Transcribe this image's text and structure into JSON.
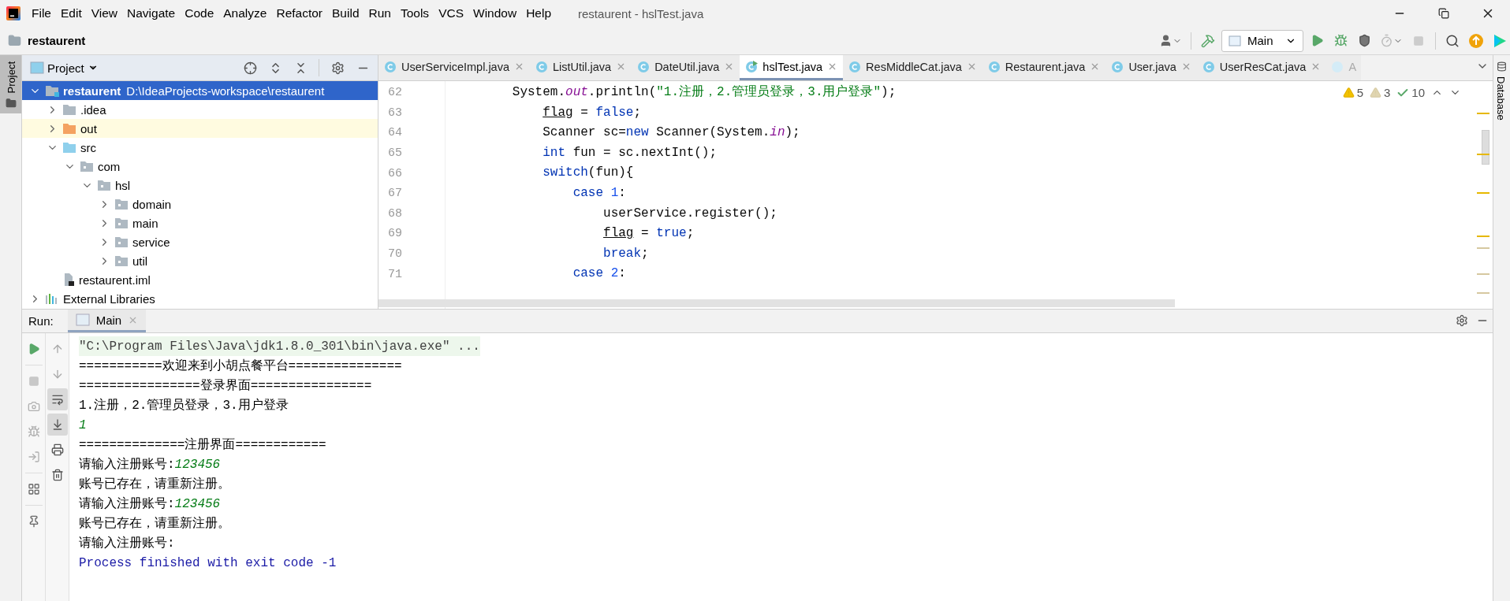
{
  "menu": [
    "File",
    "Edit",
    "View",
    "Navigate",
    "Code",
    "Analyze",
    "Refactor",
    "Build",
    "Run",
    "Tools",
    "VCS",
    "Window",
    "Help"
  ],
  "window": {
    "title": "restaurent - hslTest.java"
  },
  "breadcrumb": "restaurent",
  "run_config": "Main",
  "left_stripe": [
    "Project"
  ],
  "project_panel": {
    "title": "Project",
    "tree": [
      {
        "label": "restaurent",
        "path": "D:\\IdeaProjects-workspace\\restaurent",
        "kind": "module",
        "expanded": true,
        "selected": true,
        "children": [
          {
            "label": ".idea",
            "kind": "folder",
            "expanded": false,
            "selected": false
          },
          {
            "label": "out",
            "kind": "excluded",
            "expanded": false,
            "selected": false
          },
          {
            "label": "src",
            "kind": "source",
            "expanded": true,
            "selected": false,
            "children": [
              {
                "label": "com",
                "kind": "package",
                "expanded": true,
                "selected": false,
                "children": [
                  {
                    "label": "hsl",
                    "kind": "package",
                    "expanded": true,
                    "selected": false,
                    "children": [
                      {
                        "label": "domain",
                        "kind": "package",
                        "expanded": false,
                        "selected": false
                      },
                      {
                        "label": "main",
                        "kind": "package",
                        "expanded": false,
                        "selected": false
                      },
                      {
                        "label": "service",
                        "kind": "package",
                        "expanded": false,
                        "selected": false
                      },
                      {
                        "label": "util",
                        "kind": "package",
                        "expanded": false,
                        "selected": false
                      }
                    ]
                  }
                ]
              }
            ]
          },
          {
            "label": "restaurent.iml",
            "kind": "file",
            "selected": false
          }
        ]
      },
      {
        "label": "External Libraries",
        "kind": "libraries",
        "expanded": false,
        "selected": false
      }
    ]
  },
  "editor": {
    "tabs": [
      {
        "label": "UserServiceImpl.java",
        "selected": false,
        "runnable": false
      },
      {
        "label": "ListUtil.java",
        "selected": false,
        "runnable": false
      },
      {
        "label": "DateUtil.java",
        "selected": false,
        "runnable": false
      },
      {
        "label": "hslTest.java",
        "selected": true,
        "runnable": true
      },
      {
        "label": "ResMiddleCat.java",
        "selected": false,
        "runnable": false
      },
      {
        "label": "Restaurent.java",
        "selected": false,
        "runnable": false
      },
      {
        "label": "User.java",
        "selected": false,
        "runnable": false
      },
      {
        "label": "UserResCat.java",
        "selected": false,
        "runnable": false
      },
      {
        "label": "A",
        "selected": false,
        "runnable": false,
        "cut": true
      }
    ],
    "inspections": [
      {
        "kind": "warning",
        "count": "5"
      },
      {
        "kind": "weak",
        "count": "3"
      },
      {
        "kind": "typo",
        "count": "10"
      }
    ],
    "lines": [
      {
        "number": "62",
        "tokens": [
          {
            "kind": "plain",
            "text": "        System."
          },
          {
            "kind": "static",
            "text": "out"
          },
          {
            "kind": "plain",
            "text": ".println("
          },
          {
            "kind": "string",
            "text": "\"1.注册，2.管理员登录，3.用户登录\""
          },
          {
            "kind": "plain",
            "text": ");"
          }
        ]
      },
      {
        "number": "63",
        "tokens": [
          {
            "kind": "var",
            "text": "            flag"
          },
          {
            "kind": "plain",
            "text": " = "
          },
          {
            "kind": "keyword",
            "text": "false"
          },
          {
            "kind": "plain",
            "text": ";"
          }
        ]
      },
      {
        "number": "64",
        "tokens": [
          {
            "kind": "plain",
            "text": "            Scanner sc="
          },
          {
            "kind": "keyword",
            "text": "new"
          },
          {
            "kind": "plain",
            "text": " Scanner(System."
          },
          {
            "kind": "static",
            "text": "in"
          },
          {
            "kind": "plain",
            "text": ");"
          }
        ]
      },
      {
        "number": "65",
        "tokens": [
          {
            "kind": "keyword",
            "text": "            int"
          },
          {
            "kind": "plain",
            "text": " fun = sc.nextInt();"
          }
        ]
      },
      {
        "number": "66",
        "tokens": [
          {
            "kind": "keyword",
            "text": "            switch"
          },
          {
            "kind": "plain",
            "text": "(fun){"
          }
        ]
      },
      {
        "number": "67",
        "tokens": [
          {
            "kind": "keyword",
            "text": "                case "
          },
          {
            "kind": "number",
            "text": "1"
          },
          {
            "kind": "plain",
            "text": ":"
          }
        ]
      },
      {
        "number": "68",
        "tokens": [
          {
            "kind": "plain",
            "text": "                    userService.register();"
          }
        ]
      },
      {
        "number": "69",
        "tokens": [
          {
            "kind": "var",
            "text": "                    flag"
          },
          {
            "kind": "plain",
            "text": " = "
          },
          {
            "kind": "keyword",
            "text": "true"
          },
          {
            "kind": "plain",
            "text": ";"
          }
        ]
      },
      {
        "number": "70",
        "tokens": [
          {
            "kind": "keyword",
            "text": "                    break"
          },
          {
            "kind": "plain",
            "text": ";"
          }
        ]
      },
      {
        "number": "71",
        "tokens": [
          {
            "kind": "keyword",
            "text": "                case "
          },
          {
            "kind": "number",
            "text": "2"
          },
          {
            "kind": "plain",
            "text": ":"
          }
        ]
      }
    ]
  },
  "right_stripe": [
    "Database"
  ],
  "run_panel": {
    "label": "Run:",
    "tabs": [
      {
        "label": "Main",
        "selected": true
      }
    ],
    "tools": [
      {
        "on": false
      },
      {
        "on": false
      },
      {
        "on": true
      },
      {
        "on": true
      },
      {
        "on": false
      },
      {
        "on": false
      }
    ],
    "console": [
      {
        "kind": "command",
        "text": "\"C:\\Program Files\\Java\\jdk1.8.0_301\\bin\\java.exe\" ..."
      },
      {
        "kind": "output",
        "text": "===========欢迎来到小胡点餐平台==============="
      },
      {
        "kind": "output",
        "text": "================登录界面================"
      },
      {
        "kind": "output",
        "text": "1.注册，2.管理员登录，3.用户登录"
      },
      {
        "kind": "input",
        "text": "1"
      },
      {
        "kind": "output",
        "text": "==============注册界面============"
      },
      {
        "kind": "output",
        "text": "请输入注册账号:",
        "input": "123456"
      },
      {
        "kind": "output",
        "text": "账号已存在，请重新注册。"
      },
      {
        "kind": "output",
        "text": "请输入注册账号:",
        "input": "123456"
      },
      {
        "kind": "output",
        "text": "账号已存在，请重新注册。"
      },
      {
        "kind": "output",
        "text": "请输入注册账号:"
      },
      {
        "kind": "exit",
        "text": "Process finished with exit code -1"
      }
    ]
  }
}
